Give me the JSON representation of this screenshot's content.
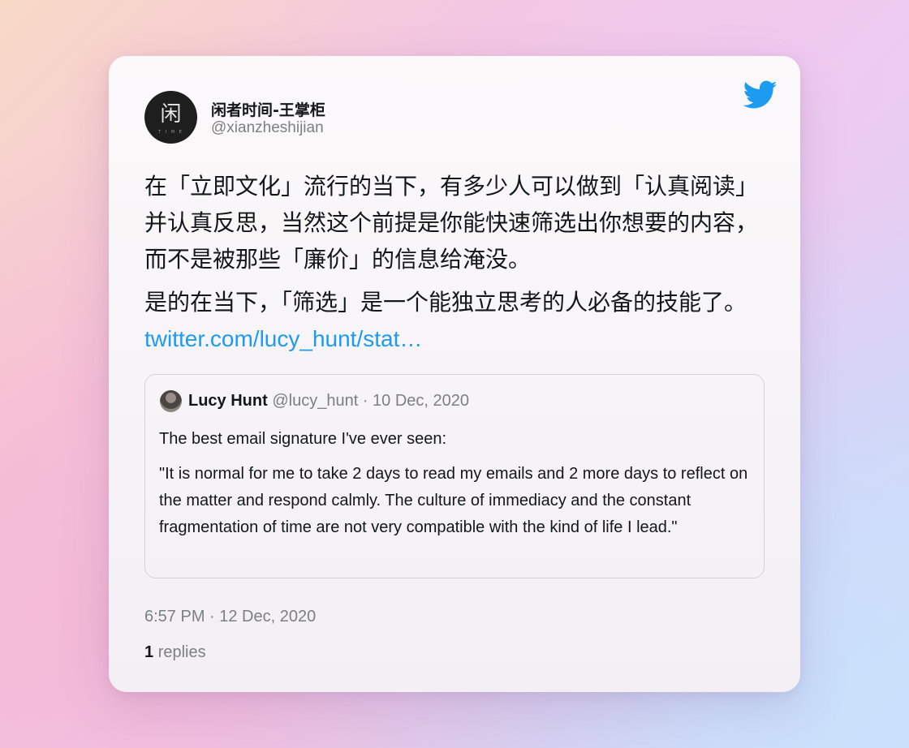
{
  "author": {
    "display_name": "闲者时间-王掌柜",
    "handle": "@xianzheshijian",
    "avatar_glyph": "闲",
    "avatar_caption": "T I M E"
  },
  "tweet": {
    "paragraphs": [
      "在「立即文化」流行的当下，有多少人可以做到「认真阅读」并认真反思，当然这个前提是你能快速筛选出你想要的内容，而不是被那些「廉价」的信息给淹没。",
      "是的在当下，「筛选」是一个能独立思考的人必备的技能了。"
    ],
    "link_text": "twitter.com/lucy_hunt/stat…"
  },
  "quoted_tweet": {
    "name": "Lucy Hunt",
    "meta": "@lucy_hunt · 10 Dec, 2020",
    "paragraphs": [
      "The best email signature I've ever seen:",
      "\"It is normal for me to take 2 days to read my emails and 2 more days to reflect on the matter and respond calmly. The culture of immediacy and the constant fragmentation of time are not very compatible with the kind of life I lead.\""
    ]
  },
  "timestamp": "6:57 PM · 12 Dec, 2020",
  "replies": {
    "count": "1",
    "label": "replies"
  },
  "icons": {
    "brand": "twitter-bird-icon"
  },
  "colors": {
    "link": "#1d9bf0",
    "brand": "#1d9bf0",
    "text": "#14171a",
    "muted": "#7c7f84"
  }
}
